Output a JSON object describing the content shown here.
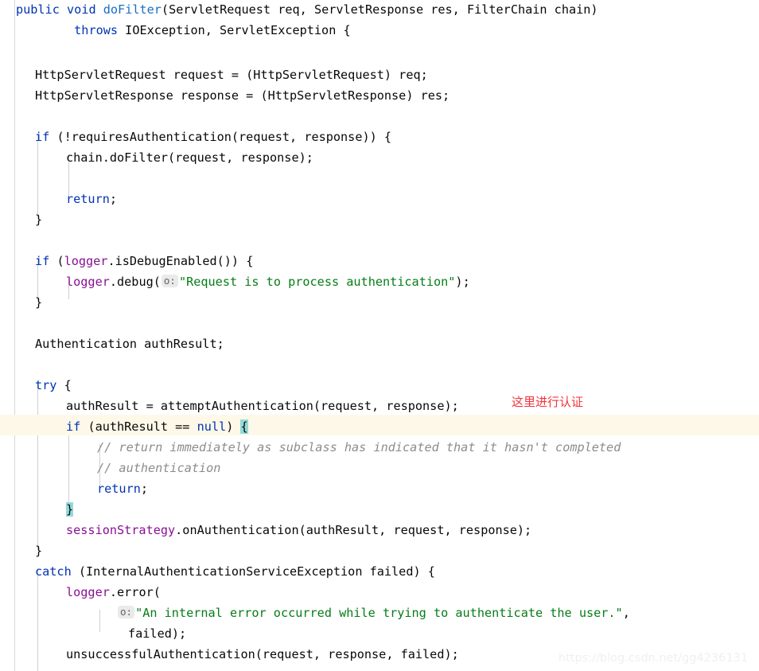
{
  "editor": {
    "language": "java",
    "theme": "IntelliJ Light",
    "font_size_px": 15,
    "line_height_px": 26,
    "colors": {
      "background": "#ffffff",
      "foreground": "#080808",
      "keyword": "#0033b3",
      "method": "#1a6fc4",
      "field": "#871094",
      "string": "#067d17",
      "comment": "#8c8c8c",
      "caret_line": "#fdf8e8",
      "brace_match": "#93d9d9",
      "indent_guide": "#d0d0d0",
      "gutter_border": "#d8d8d8",
      "annotation": "#f4333c",
      "watermark": "#f0f0f0"
    },
    "caret_line_number": 17,
    "lines": [
      {
        "n": 1,
        "indent": 0,
        "text": "public void doFilter(ServletRequest req, ServletResponse res, FilterChain chain)"
      },
      {
        "n": 2,
        "indent": 0,
        "text": "        throws IOException, ServletException {"
      },
      {
        "n": 3,
        "indent": 0,
        "text": ""
      },
      {
        "n": 4,
        "indent": 0,
        "text": "    HttpServletRequest request = (HttpServletRequest) req;"
      },
      {
        "n": 5,
        "indent": 0,
        "text": "    HttpServletResponse response = (HttpServletResponse) res;"
      },
      {
        "n": 6,
        "indent": 0,
        "text": ""
      },
      {
        "n": 7,
        "indent": 0,
        "text": "    if (!requiresAuthentication(request, response)) {"
      },
      {
        "n": 8,
        "indent": 0,
        "text": "        chain.doFilter(request, response);"
      },
      {
        "n": 9,
        "indent": 0,
        "text": ""
      },
      {
        "n": 10,
        "indent": 0,
        "text": "        return;"
      },
      {
        "n": 11,
        "indent": 0,
        "text": "    }"
      },
      {
        "n": 12,
        "indent": 0,
        "text": ""
      },
      {
        "n": 13,
        "indent": 0,
        "text": "    if (logger.isDebugEnabled()) {"
      },
      {
        "n": 14,
        "indent": 0,
        "text": "        logger.debug( o: \"Request is to process authentication\");"
      },
      {
        "n": 15,
        "indent": 0,
        "text": "    }"
      },
      {
        "n": 16,
        "indent": 0,
        "text": ""
      },
      {
        "n": 17,
        "indent": 0,
        "text": "    Authentication authResult;"
      },
      {
        "n": 18,
        "indent": 0,
        "text": ""
      },
      {
        "n": 19,
        "indent": 0,
        "text": "    try {"
      },
      {
        "n": 20,
        "indent": 0,
        "text": "        authResult = attemptAuthentication(request, response);"
      },
      {
        "n": 21,
        "indent": 0,
        "text": "        if (authResult == null) {"
      },
      {
        "n": 22,
        "indent": 0,
        "text": "            // return immediately as subclass has indicated that it hasn't completed"
      },
      {
        "n": 23,
        "indent": 0,
        "text": "            // authentication"
      },
      {
        "n": 24,
        "indent": 0,
        "text": "            return;"
      },
      {
        "n": 25,
        "indent": 0,
        "text": "        }"
      },
      {
        "n": 26,
        "indent": 0,
        "text": "        sessionStrategy.onAuthentication(authResult, request, response);"
      },
      {
        "n": 27,
        "indent": 0,
        "text": "    }"
      },
      {
        "n": 28,
        "indent": 0,
        "text": "    catch (InternalAuthenticationServiceException failed) {"
      },
      {
        "n": 29,
        "indent": 0,
        "text": "        logger.error("
      },
      {
        "n": 30,
        "indent": 0,
        "text": "                o: \"An internal error occurred while trying to authenticate the user.\","
      },
      {
        "n": 31,
        "indent": 0,
        "text": "                failed);"
      },
      {
        "n": 32,
        "indent": 0,
        "text": "        unsuccessfulAuthentication(request, response, failed);"
      }
    ],
    "parameter_hints": [
      {
        "label": "o:",
        "on_line": 14
      },
      {
        "label": "o:",
        "on_line": 30
      }
    ],
    "strings": [
      "\"Request is to process authentication\"",
      "\"An internal error occurred while trying to authenticate the user.\""
    ],
    "comments": [
      "// return immediately as subclass has indicated that it hasn't completed",
      "// authentication"
    ],
    "keywords_used": [
      "public",
      "void",
      "throws",
      "if",
      "return",
      "try",
      "catch",
      "null"
    ]
  },
  "annotation": {
    "text": "这里进行认证",
    "color": "#f4333c"
  },
  "watermark": {
    "text": "https://blog.csdn.net/gg4236131"
  },
  "tokens": {
    "l1_public": "public",
    "l1_void": "void",
    "l1_doFilter": "doFilter",
    "l1_sig": "(ServletRequest req, ServletResponse res, FilterChain chain)",
    "l2_throws": "throws",
    "l2_rest": " IOException, ServletException {",
    "l4": "HttpServletRequest request = (HttpServletRequest) req;",
    "l5": "HttpServletResponse response = (HttpServletResponse) res;",
    "l7_if": "if",
    "l7_rest": " (!requiresAuthentication(request, response)) {",
    "l8": "chain.doFilter(request, response);",
    "l10_return": "return",
    "l10_semi": ";",
    "l11_brace": "}",
    "l13_if": "if",
    "l13_open": " (",
    "l13_logger": "logger",
    "l13_rest": ".isDebugEnabled()) {",
    "l14_logger": "logger",
    "l14_debug": ".debug(",
    "l14_hint": "o:",
    "l14_str": "\"Request is to process authentication\"",
    "l14_tail": ");",
    "l15_brace": "}",
    "l17": "Authentication authResult;",
    "l19_try": "try",
    "l19_brace": " {",
    "l20": "authResult = attemptAuthentication(request, response);",
    "l21_if": "if",
    "l21_cond": " (authResult == ",
    "l21_null": "null",
    "l21_close": ") ",
    "l21_brace": "{",
    "l22_cmt": "// return immediately as subclass has indicated that it hasn't completed",
    "l23_cmt": "// authentication",
    "l24_return": "return",
    "l24_semi": ";",
    "l25_brace": "}",
    "l26_field": "sessionStrategy",
    "l26_rest": ".onAuthentication(authResult, request, response);",
    "l27_brace": "}",
    "l28_catch": "catch",
    "l28_rest": " (InternalAuthenticationServiceException failed) {",
    "l29_logger": "logger",
    "l29_rest": ".error(",
    "l30_hint": "o:",
    "l30_str": "\"An internal error occurred while trying to authenticate the user.\"",
    "l30_comma": ",",
    "l31": "failed);",
    "l32": "unsuccessfulAuthentication(request, response, failed);"
  }
}
